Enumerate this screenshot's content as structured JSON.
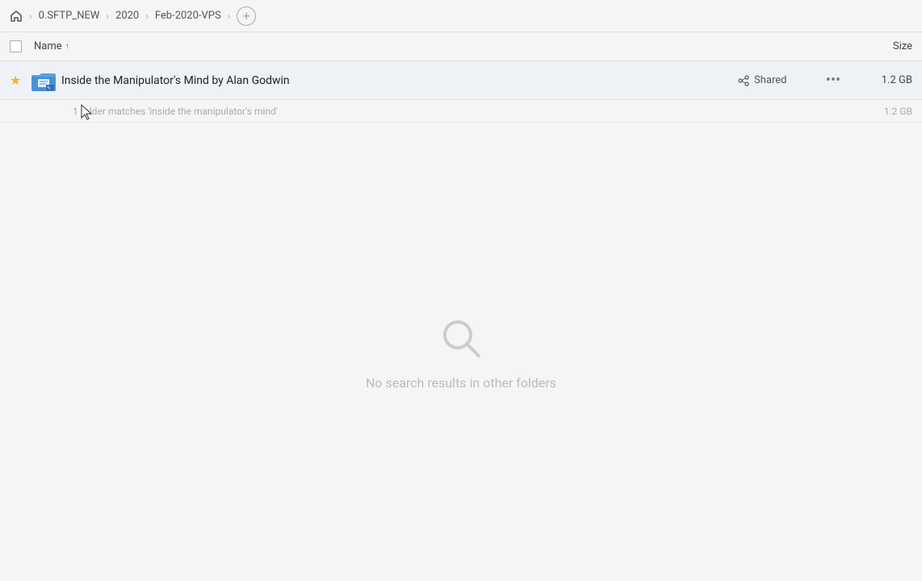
{
  "breadcrumb": {
    "home_label": "Home",
    "items": [
      {
        "label": "0.SFTP_NEW"
      },
      {
        "label": "2020"
      },
      {
        "label": "Feb-2020-VPS"
      }
    ],
    "add_label": "+"
  },
  "columns": {
    "name_label": "Name",
    "sort_arrow": "↑",
    "size_label": "Size"
  },
  "file_row": {
    "name": "Inside the Manipulator's Mind by Alan Godwin",
    "shared_label": "Shared",
    "size": "1.2 GB",
    "more_icon": "•••"
  },
  "match_row": {
    "text": "1 folder matches 'inside the manipulator's mind'",
    "size": "1.2 GB"
  },
  "no_results": {
    "text": "No search results in other folders"
  }
}
